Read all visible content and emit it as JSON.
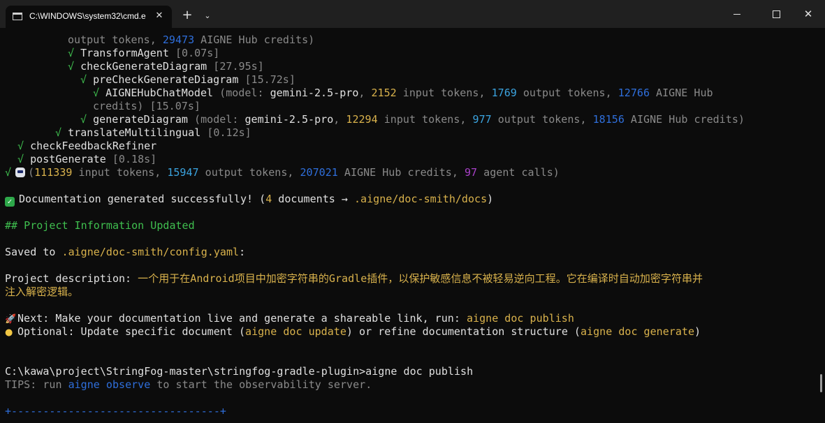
{
  "window": {
    "tab_title": "C:\\WINDOWS\\system32\\cmd.e",
    "tab_close": "✕",
    "new_tab": "+",
    "dropdown": "⌄",
    "close_glyph": "✕"
  },
  "terminal": {
    "l1": {
      "p1": "output tokens, ",
      "n1": "29473",
      "p2": " AIGNE Hub credits)"
    },
    "l2": {
      "check": "√ ",
      "name": "TransformAgent",
      "time": " [0.07s]"
    },
    "l3": {
      "check": "√ ",
      "name": "checkGenerateDiagram",
      "time": " [27.95s]"
    },
    "l4": {
      "check": "√ ",
      "name": "preCheckGenerateDiagram",
      "time": " [15.72s]"
    },
    "l5": {
      "check": "√ ",
      "name": "AIGNEHubChatModel",
      "p1": " (model: ",
      "model": "gemini-2.5-pro",
      "p2": ", ",
      "n1": "2152",
      "p3": " input tokens, ",
      "n2": "1769",
      "p4": " output tokens, ",
      "n3": "12766",
      "p5": " AIGNE Hub"
    },
    "l6": {
      "text": "credits) [15.07s]"
    },
    "l7": {
      "check": "√ ",
      "name": "generateDiagram",
      "p1": " (model: ",
      "model": "gemini-2.5-pro",
      "p2": ", ",
      "n1": "12294",
      "p3": " input tokens, ",
      "n2": "977",
      "p4": " output tokens, ",
      "n3": "18156",
      "p5": " AIGNE Hub credits)"
    },
    "l8": {
      "check": "√ ",
      "name": "translateMultilingual",
      "time": " [0.12s]"
    },
    "l9": {
      "check": "√ ",
      "name": "checkFeedbackRefiner"
    },
    "l10": {
      "check": "√ ",
      "name": "postGenerate",
      "time": " [0.18s]"
    },
    "l11": {
      "check": "√",
      "p1": "(",
      "n1": "111339",
      "p2": " input tokens, ",
      "n2": "15947",
      "p3": " output tokens, ",
      "n3": "207021",
      "p4": " AIGNE Hub credits, ",
      "n4": "97",
      "p5": " agent calls)"
    },
    "l12": {
      "check_glyph": "✓",
      "p1": "Documentation generated successfully! (",
      "n1": "4",
      "p2": " documents → ",
      "path": ".aigne/doc-smith/docs",
      "p3": ")"
    },
    "l13": {
      "text": "## Project Information Updated"
    },
    "l14": {
      "p1": "Saved to ",
      "path": ".aigne/doc-smith/config.yaml",
      "p2": ":"
    },
    "l15": {
      "label": "Project description: ",
      "desc": "一个用于在Android项目中加密字符串的Gradle插件，以保护敏感信息不被轻易逆向工程。它在编译时自动加密字符串并"
    },
    "l16": {
      "desc": "注入解密逻辑。"
    },
    "l17": {
      "rocket_glyph": "🚀",
      "p1": "Next: Make your documentation live and generate a shareable link, run: ",
      "cmd": "aigne doc publish"
    },
    "l18": {
      "bulb_glyph": "●",
      "p1": "Optional: Update specific document (",
      "cmd1": "aigne doc update",
      "p2": ") or refine documentation structure (",
      "cmd2": "aigne doc generate",
      "p3": ")"
    },
    "l19": {
      "text": "C:\\kawa\\project\\StringFog-master\\stringfog-gradle-plugin>aigne doc publish"
    },
    "l20": {
      "p1": "TIPS: run ",
      "cmd": "aigne observe",
      "p2": " to start the observability server."
    },
    "l21": {
      "text": "+---------------------------------+"
    }
  },
  "colors": {
    "dim": "#8a8a8a",
    "blue": "#2f6fdc",
    "yellow": "#d9b24c",
    "green": "#3fbf4f",
    "cyan": "#3ba4e0",
    "purple": "#a840c8",
    "background": "#0c0c0c",
    "titlebar": "#202020"
  }
}
